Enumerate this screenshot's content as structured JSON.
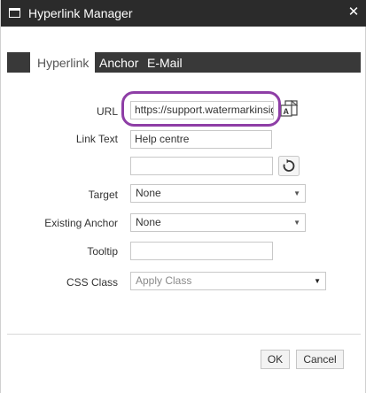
{
  "window": {
    "title": "Hyperlink Manager",
    "close_glyph": "✕"
  },
  "tabs": [
    {
      "label": "Hyperlink",
      "active": true
    },
    {
      "label": "Anchor",
      "active": false
    },
    {
      "label": "E-Mail",
      "active": false
    }
  ],
  "form": {
    "url": {
      "label": "URL",
      "value": "https://support.watermarkinsights"
    },
    "link_text": {
      "label": "Link Text",
      "value": "Help centre"
    },
    "extra_field": {
      "value": ""
    },
    "target": {
      "label": "Target",
      "value": "None"
    },
    "existing_anchor": {
      "label": "Existing Anchor",
      "value": "None"
    },
    "tooltip": {
      "label": "Tooltip",
      "value": ""
    },
    "css_class": {
      "label": "CSS Class",
      "value": "Apply Class"
    }
  },
  "buttons": {
    "ok": "OK",
    "cancel": "Cancel"
  },
  "icons": {
    "title": "window-icon",
    "document_manager": "document-manager-icon",
    "refresh": "refresh-icon",
    "dropdown": "caret-down-icon"
  },
  "colors": {
    "titlebar": "#2b2b2b",
    "tabbar": "#393939",
    "highlight": "#8e3ea6"
  }
}
